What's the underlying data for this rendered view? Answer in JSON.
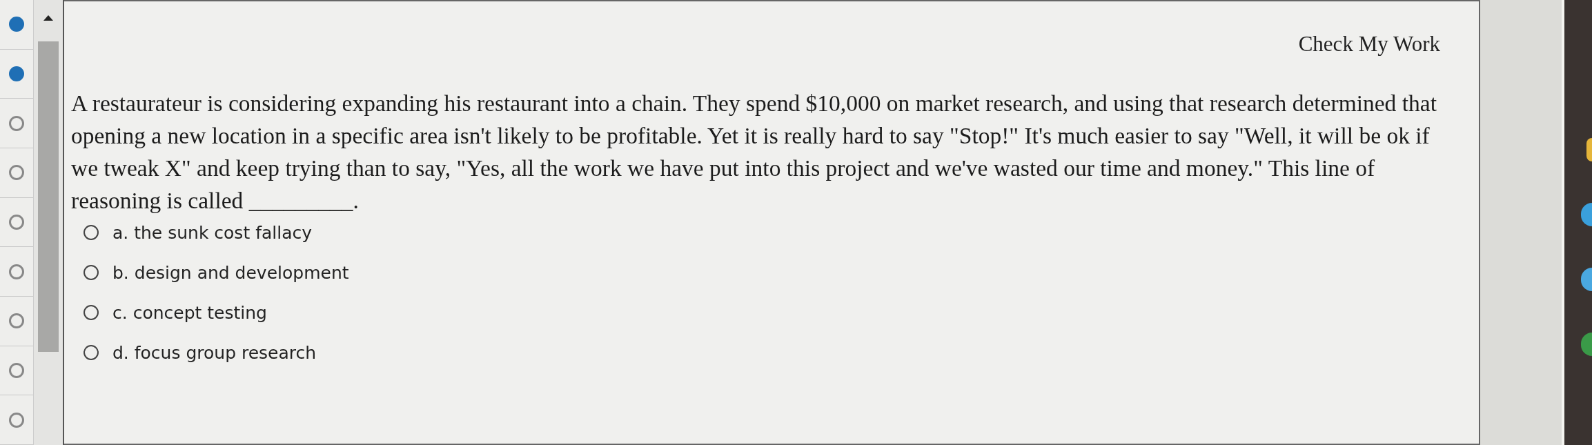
{
  "question_nav": [
    {
      "answered": true
    },
    {
      "answered": true
    },
    {
      "answered": false
    },
    {
      "answered": false
    },
    {
      "answered": false
    },
    {
      "answered": false
    },
    {
      "answered": false
    },
    {
      "answered": false
    },
    {
      "answered": false
    }
  ],
  "check_button": {
    "label": "Check My Work"
  },
  "question": {
    "text": "A restaurateur is considering expanding his restaurant into a chain. They spend $10,000 on market research, and using that research determined that opening a new location in a specific area isn't likely to be profitable. Yet it is really hard to say \"Stop!\" It's much easier to say \"Well, it will be ok if we tweak X\" and keep trying than to say, \"Yes, all the work we have put into this project and we've wasted our time and money.\" This line of reasoning is called _________."
  },
  "options": [
    {
      "label": "a. the sunk cost fallacy",
      "selected": false
    },
    {
      "label": "b. design and development",
      "selected": false
    },
    {
      "label": "c. concept testing",
      "selected": false
    },
    {
      "label": "d. focus group research",
      "selected": false
    }
  ]
}
